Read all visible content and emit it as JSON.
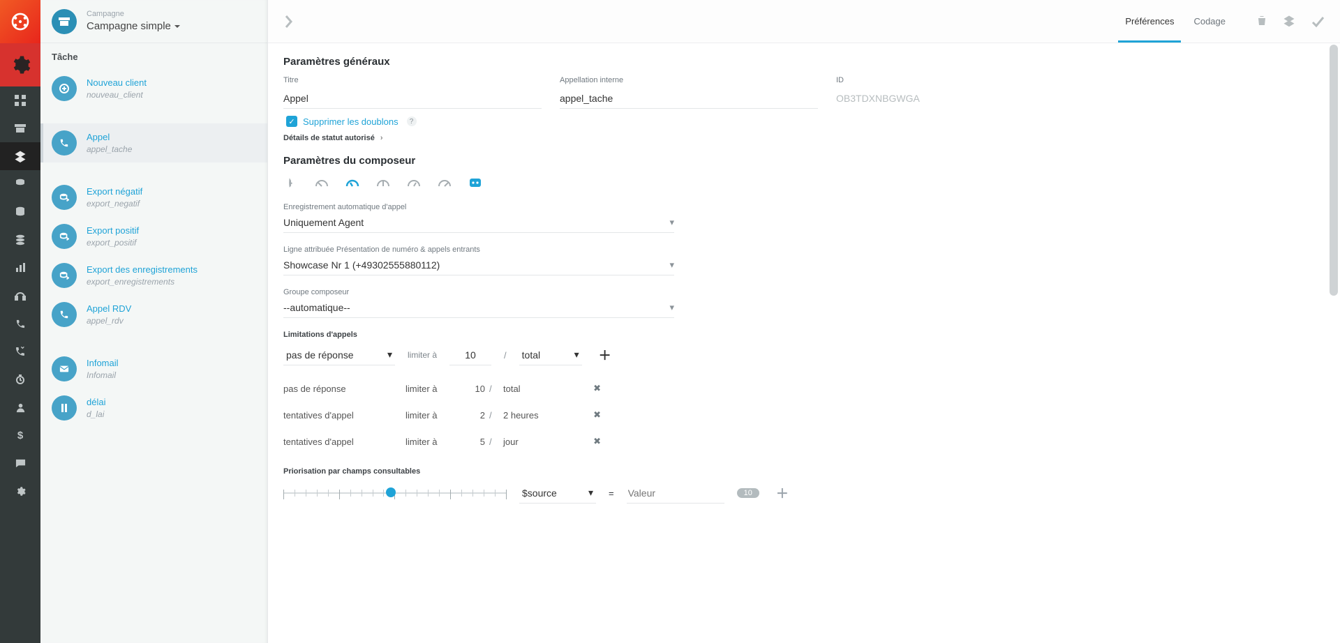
{
  "header": {
    "eyebrow": "Campagne",
    "title": "Campagne simple"
  },
  "sidebar": {
    "section_label": "Tâche",
    "items": [
      {
        "icon": "plus",
        "title": "Nouveau client",
        "sub": "nouveau_client"
      },
      {
        "spacer": true
      },
      {
        "icon": "phone",
        "title": "Appel",
        "sub": "appel_tache",
        "active": true
      },
      {
        "spacer": true
      },
      {
        "icon": "export",
        "title": "Export négatif",
        "sub": "export_negatif"
      },
      {
        "icon": "export",
        "title": "Export positif",
        "sub": "export_positif"
      },
      {
        "icon": "export",
        "title": "Export des enregistrements",
        "sub": "export_enregistrements"
      },
      {
        "icon": "phone",
        "title": "Appel RDV",
        "sub": "appel_rdv"
      },
      {
        "spacer": true
      },
      {
        "icon": "mail",
        "title": "Infomail",
        "sub": "Infomail"
      },
      {
        "icon": "pause",
        "title": "délai",
        "sub": "d_lai"
      }
    ]
  },
  "tabs": {
    "preferences": "Préférences",
    "coding": "Codage"
  },
  "actions": {
    "delete_title": "Supprimer",
    "layers_title": "Couches",
    "save_title": "Enregistrer"
  },
  "sections": {
    "general": "Paramètres généraux",
    "dialer": "Paramètres du composeur"
  },
  "general": {
    "title_label": "Titre",
    "title_value": "Appel",
    "intern_label": "Appellation interne",
    "intern_value": "appel_tache",
    "id_label": "ID",
    "id_value": "OB3TDXNBGWGA",
    "checkbox_label": "Supprimer les doublons",
    "disclose": "Détails de statut autorisé"
  },
  "dialer": {
    "rec_label": "Enregistrement automatique d'appel",
    "rec_value": "Uniquement Agent",
    "line_label": "Ligne attribuée Présentation de numéro & appels entrants",
    "line_value": "Showcase Nr 1 (+49302555880112)",
    "group_label": "Groupe composeur",
    "group_value": "--automatique--"
  },
  "limits": {
    "heading": "Limitations d'appels",
    "limit_word": "limiter à",
    "new_reason": "pas de réponse",
    "new_count": "10",
    "new_unit": "total",
    "rows": [
      {
        "reason": "pas de réponse",
        "count": "10",
        "unit": "total"
      },
      {
        "reason": "tentatives d'appel",
        "count": "2",
        "unit": "2 heures"
      },
      {
        "reason": "tentatives d'appel",
        "count": "5",
        "unit": "jour"
      }
    ]
  },
  "priority": {
    "heading": "Priorisation par champs consultables",
    "source": "$source",
    "equals": "=",
    "placeholder": "Valeur",
    "badge": "10"
  }
}
